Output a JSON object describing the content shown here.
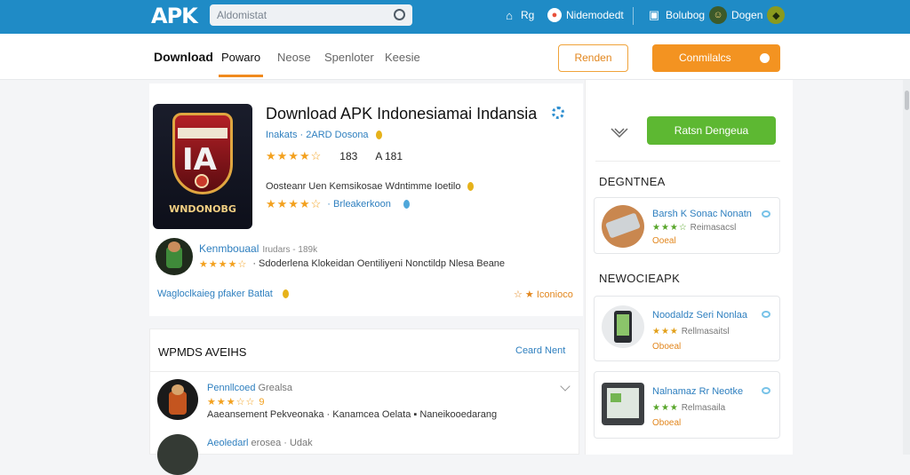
{
  "header": {
    "logo": "APK",
    "search_placeholder": "Aldomistat",
    "items": [
      {
        "icon": "house-icon",
        "label": "Rg"
      },
      {
        "icon": "record-icon",
        "label": "Nidemodedt"
      },
      {
        "icon": "tag-icon",
        "label": "Bolubog"
      },
      {
        "icon": "avatar",
        "label": "Dogen"
      }
    ]
  },
  "nav": {
    "tabs": [
      "Download",
      "Powaro",
      "Neose",
      "Spenloter",
      "Keesie"
    ],
    "active_tab": "Powaro",
    "outline_button": "Renden",
    "orange_button": "Conmilalcs"
  },
  "app": {
    "title": "Download APK Indonesiamai Indansia",
    "icon_text": "WNDONOBG",
    "developer": "Inakats · 2ARD Dosona",
    "stars": "★★★★☆",
    "rating_count": "183",
    "rating_extra": "A 181",
    "description": "Oosteanr Uen Kemsikosae Wdntimme Ioetilo",
    "stars_line_stars": "★★★★☆",
    "stars_line_text": "· Brleakerkoon",
    "review": {
      "name": "Kenmbouaal",
      "meta": "Irudars - 189k",
      "stars": "★★★★☆",
      "text": "· Sdoderlena Klokeidan Oentiliyeni Nonctildp Nlesa Beane"
    },
    "link_left": "Wagloclkaieg pfaker Batlat",
    "link_right": "☆ ★ Iconioco"
  },
  "reviews": {
    "heading": "WPMDS AVEIHS",
    "link": "Ceard Nent",
    "items": [
      {
        "name": "Pennllcoed",
        "name_extra": "Grealsa",
        "stars": "★★★☆☆ 9",
        "text": "Aaeansement Pekveonaka · Kanamcea Oelata ▪ Naneikooedarang"
      },
      {
        "name": "Aeoledarl",
        "name_extra": "erosea · Udak",
        "stars": "",
        "text": ""
      }
    ]
  },
  "sidebar": {
    "green_button": "Ratsn Dengeua",
    "sections": [
      {
        "heading": "DEGNTNEA",
        "items": [
          {
            "title": "Barsh K Sonac Nonatn",
            "stars": "★★★☆",
            "sub": "Reimasacsl",
            "link": "Ooeal"
          }
        ]
      },
      {
        "heading": "NEWOCIEAPK",
        "items": [
          {
            "title": "Noodaldz Seri Nonlaa",
            "stars": "★★★",
            "sub": "Rellmasaitsl",
            "link": "Oboeal"
          },
          {
            "title": "Nalnamaz Rr Neotke",
            "stars": "★★★",
            "sub": "Relmasaila",
            "link": "Oboeal"
          }
        ]
      }
    ]
  },
  "colors": {
    "header_bg": "#1f8bc6",
    "accent_orange": "#f39321",
    "accent_green": "#5db832",
    "link_blue": "#2e7fbf",
    "star_gold": "#f3a11f"
  }
}
